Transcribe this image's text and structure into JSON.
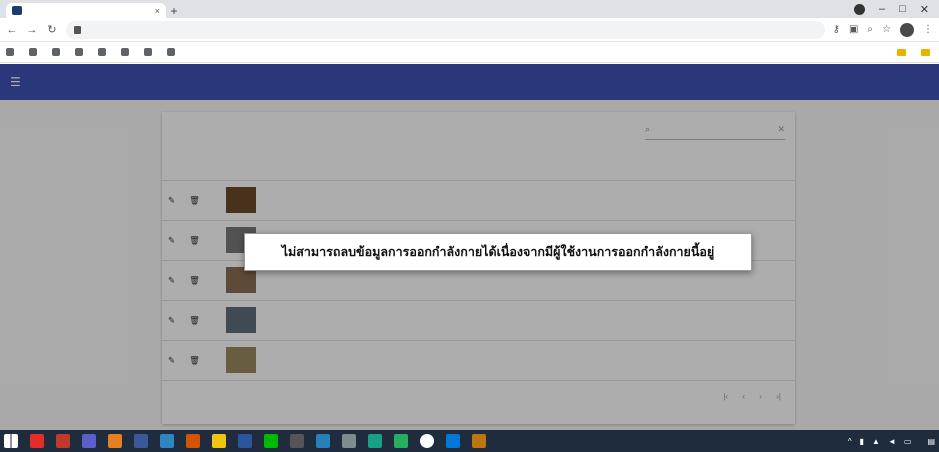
{
  "browser": {
    "tab_title": "",
    "tab_close": "×",
    "new_tab": "+",
    "window_controls": [
      "–",
      "□",
      "✕"
    ],
    "url": "",
    "bookmarks": [
      "",
      "",
      "",
      "",
      "",
      "",
      "",
      ""
    ],
    "bookmarks_right": [
      "",
      ""
    ]
  },
  "app": {
    "header_title": "",
    "header_right": "",
    "table_title": "",
    "search_placeholder": "",
    "columns": [
      "",
      "",
      "",
      "",
      ""
    ],
    "rows": [
      {
        "name": "",
        "number": "",
        "url": "",
        "thumb_color": "#6b4b2a"
      },
      {
        "name": "",
        "number": "",
        "url": "",
        "thumb_color": "#7a7a7a"
      },
      {
        "name": "",
        "number": "",
        "url": "",
        "thumb_color": "#8b6d55"
      },
      {
        "name": "",
        "number": "",
        "url": "",
        "thumb_color": "#5d6d7a"
      },
      {
        "name": "",
        "number": "",
        "url": "",
        "thumb_color": "#9b8a60"
      }
    ],
    "pagination": {
      "rows_per_page": "",
      "range": ""
    }
  },
  "dialog": {
    "message": "ไม่สามารถลบข้อมูลการออกกำลังกายได้เนื่องจากมีผู้ใช้งานการออกกำลังกายนี้อยู่"
  },
  "taskbar": {
    "clock_time": "",
    "clock_date": ""
  },
  "colors": {
    "app_bar": "#3f51b5",
    "taskbar": "#1f2c3d",
    "overlay": "rgba(0,0,0,0.32)"
  }
}
